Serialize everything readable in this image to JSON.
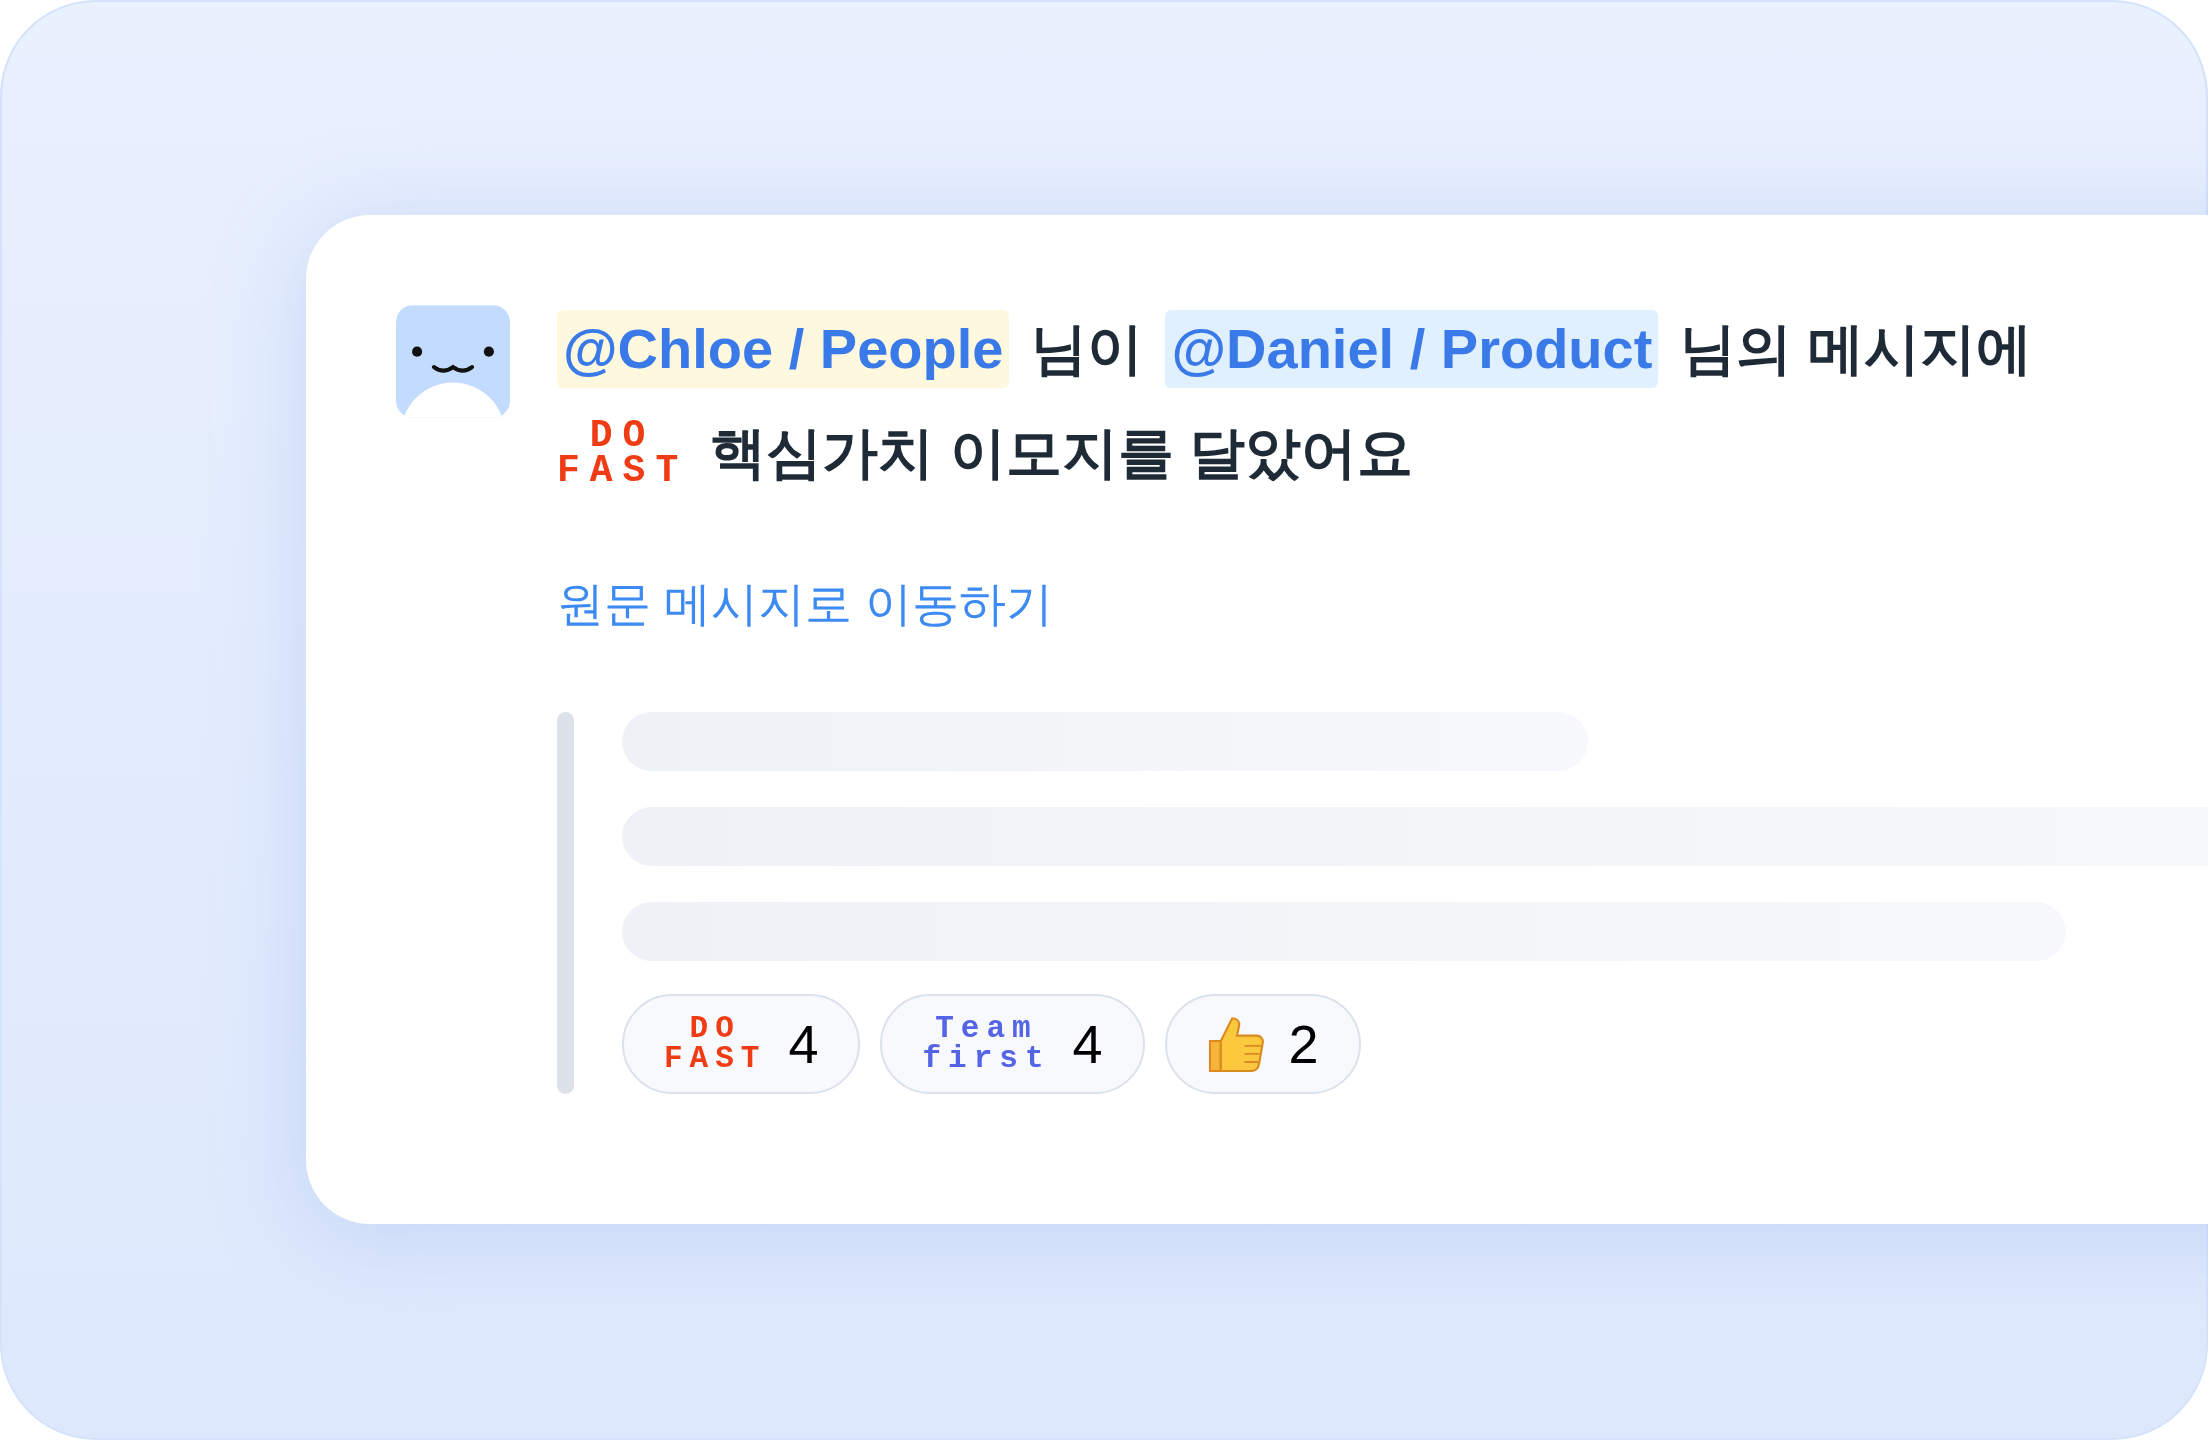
{
  "notification": {
    "message": [
      {
        "kind": "mention",
        "text": "@Chloe / People",
        "color": "#fef8df"
      },
      {
        "kind": "text",
        "text": "님이"
      },
      {
        "kind": "mention",
        "text": "@Daniel / Product",
        "color": "#e0f0fe"
      },
      {
        "kind": "text",
        "text": "님의 메시지에"
      },
      {
        "kind": "emoji",
        "lines": [
          "DO",
          "FAST"
        ],
        "color": "#f03c14"
      },
      {
        "kind": "text",
        "text": "핵심가치 이모지를 달았어요"
      }
    ],
    "link": "원문 메시지로 이동하기",
    "reactions": [
      {
        "emoji": {
          "kind": "pixel",
          "lines": [
            "DO",
            "FAST"
          ],
          "color": "#f03c14"
        },
        "count": "4"
      },
      {
        "emoji": {
          "kind": "pixel",
          "lines": [
            "Team",
            "first"
          ],
          "color": "#5563e6"
        },
        "count": "4"
      },
      {
        "emoji": {
          "kind": "thumbs-up"
        },
        "count": "2"
      }
    ]
  }
}
